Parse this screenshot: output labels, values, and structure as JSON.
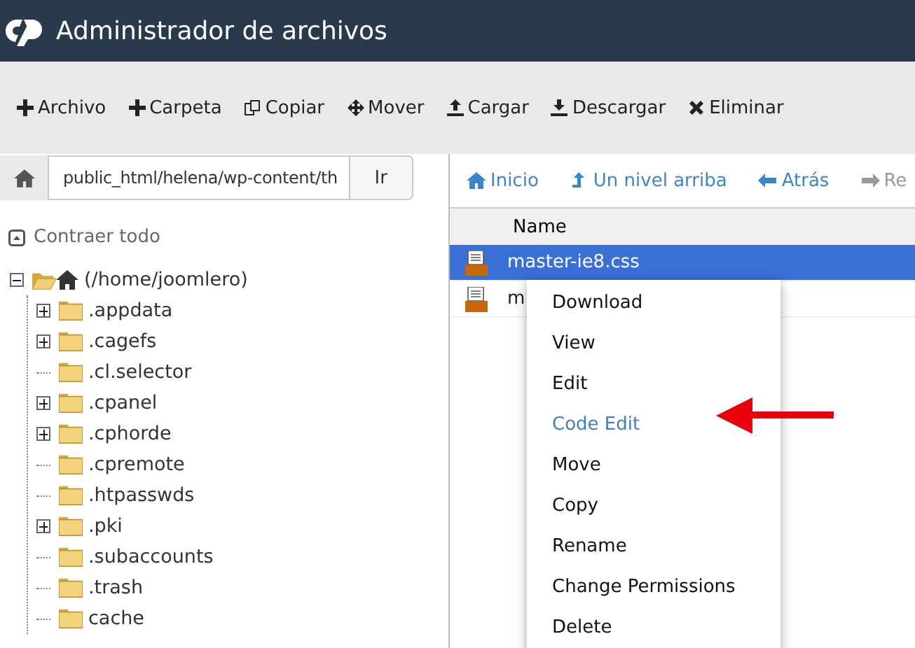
{
  "window": {
    "title": "Administrador de archivos"
  },
  "toolbar": [
    {
      "label": "Archivo",
      "kind": "plus"
    },
    {
      "label": "Carpeta",
      "kind": "plus"
    },
    {
      "label": "Copiar",
      "kind": "copy"
    },
    {
      "label": "Mover",
      "kind": "move"
    },
    {
      "label": "Cargar",
      "kind": "upload"
    },
    {
      "label": "Descargar",
      "kind": "download"
    },
    {
      "label": "Eliminar",
      "kind": "delete"
    }
  ],
  "path": {
    "value": "public_html/helena/wp-content/th",
    "go": "Ir"
  },
  "nav": [
    {
      "label": "Inicio",
      "kind": "home",
      "disabled": false
    },
    {
      "label": "Un nivel arriba",
      "kind": "up",
      "disabled": false
    },
    {
      "label": "Atrás",
      "kind": "back",
      "disabled": false
    },
    {
      "label": "Re",
      "kind": "forward",
      "disabled": true
    }
  ],
  "collapse_all": "Contraer todo",
  "tree": {
    "label": "(/home/joomlero)",
    "kind": "expanded",
    "children": [
      {
        "label": ".appdata",
        "kind": "collapsed"
      },
      {
        "label": ".cagefs",
        "kind": "collapsed"
      },
      {
        "label": ".cl.selector",
        "kind": "leaf"
      },
      {
        "label": ".cpanel",
        "kind": "collapsed"
      },
      {
        "label": ".cphorde",
        "kind": "collapsed"
      },
      {
        "label": ".cpremote",
        "kind": "leaf"
      },
      {
        "label": ".htpasswds",
        "kind": "leaf"
      },
      {
        "label": ".pki",
        "kind": "collapsed"
      },
      {
        "label": ".subaccounts",
        "kind": "leaf"
      },
      {
        "label": ".trash",
        "kind": "leaf"
      },
      {
        "label": "cache",
        "kind": "leaf"
      }
    ]
  },
  "table": {
    "columns": [
      "Name"
    ],
    "rows": [
      {
        "name": "master-ie8.css",
        "selected": true
      },
      {
        "name": "m",
        "selected": false
      }
    ]
  },
  "context_menu": [
    {
      "label": "Download",
      "highlighted": false
    },
    {
      "label": "View",
      "highlighted": false
    },
    {
      "label": "Edit",
      "highlighted": false
    },
    {
      "label": "Code Edit",
      "highlighted": true
    },
    {
      "label": "Move",
      "highlighted": false
    },
    {
      "label": "Copy",
      "highlighted": false
    },
    {
      "label": "Rename",
      "highlighted": false
    },
    {
      "label": "Change Permissions",
      "highlighted": false
    },
    {
      "label": "Delete",
      "highlighted": false
    }
  ]
}
